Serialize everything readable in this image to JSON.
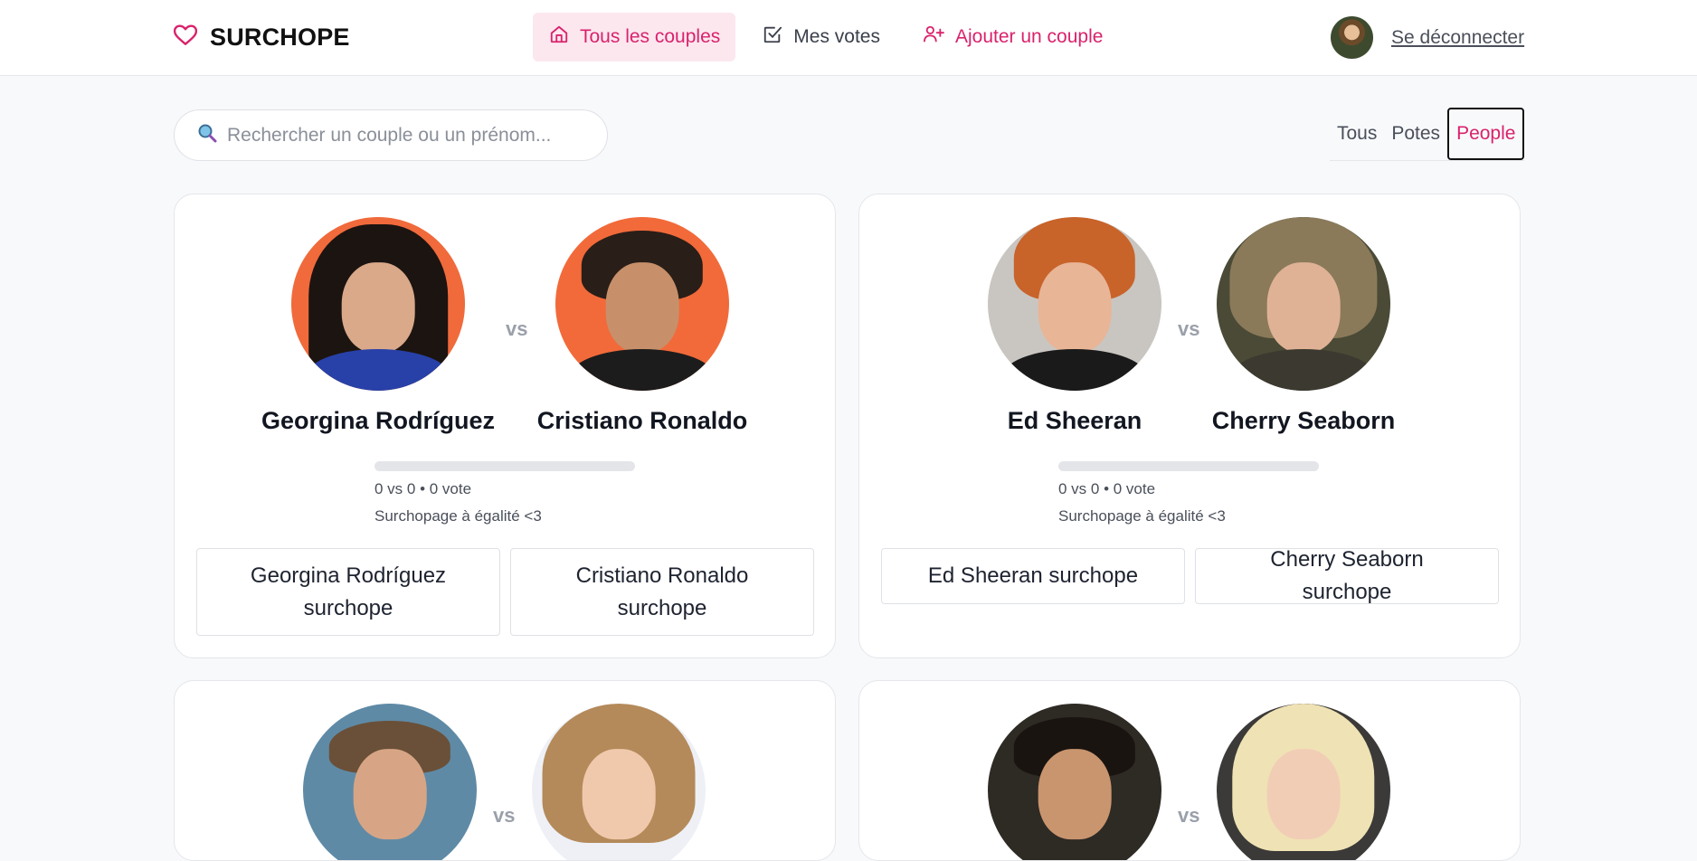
{
  "header": {
    "brand": "SURCHOPE",
    "nav": [
      {
        "label": "Tous les couples",
        "icon": "home-icon"
      },
      {
        "label": "Mes votes",
        "icon": "checkbox-icon"
      },
      {
        "label": "Ajouter un couple",
        "icon": "add-user-icon"
      }
    ],
    "logout": "Se déconnecter"
  },
  "search": {
    "placeholder": "Rechercher un couple ou un prénom..."
  },
  "filters": [
    "Tous",
    "Potes",
    "People"
  ],
  "filter_selected": "People",
  "vs_label": "vs",
  "couples": [
    {
      "left": "Georgina Rodríguez",
      "right": "Cristiano Ronaldo",
      "score": "0 vs 0 • 0 vote",
      "status": "Surchopage à égalité <3",
      "left_button": "Georgina Rodríguez surchope",
      "right_button": "Cristiano Ronaldo surchope"
    },
    {
      "left": "Ed Sheeran",
      "right": "Cherry Seaborn",
      "score": "0 vs 0 • 0 vote",
      "status": "Surchopage à égalité <3",
      "left_button": "Ed Sheeran surchope",
      "right_button": "Cherry Seaborn surchope"
    },
    {},
    {}
  ],
  "colors": {
    "accent": "#d9226c",
    "accent_bg": "#fce7ef"
  }
}
